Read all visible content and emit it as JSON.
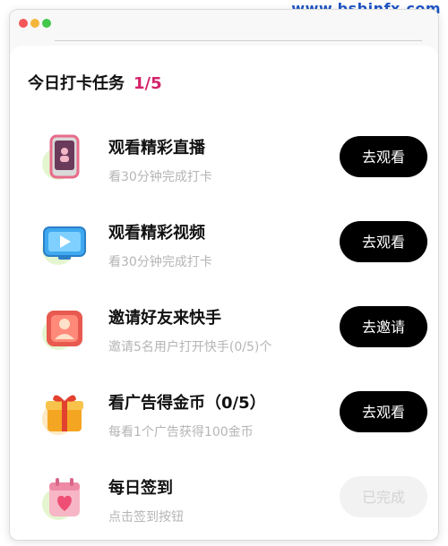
{
  "watermark": "www.bsbinfx.com",
  "header": {
    "title": "今日打卡任务",
    "progress": "1/5"
  },
  "tasks": [
    {
      "title": "观看精彩直播",
      "description": "看30分钟完成打卡",
      "button": "去观看",
      "completed": false,
      "icon": "phone-live-icon"
    },
    {
      "title": "观看精彩视频",
      "description": "看30分钟完成打卡",
      "button": "去观看",
      "completed": false,
      "icon": "video-play-icon"
    },
    {
      "title": "邀请好友来快手",
      "description": "邀请5名用户打开快手(0/5)个",
      "button": "去邀请",
      "completed": false,
      "icon": "user-invite-icon"
    },
    {
      "title": "看广告得金币（0/5）",
      "description": "每看1个广告获得100金币",
      "button": "去观看",
      "completed": false,
      "icon": "gift-box-icon"
    },
    {
      "title": "每日签到",
      "description": "点击签到按钮",
      "button": "已完成",
      "completed": true,
      "icon": "calendar-heart-icon"
    }
  ],
  "colors": {
    "accent": "#d4226a",
    "button_bg": "#000000",
    "button_done_bg": "#f2f2f2",
    "watermark": "#1f56c4"
  }
}
